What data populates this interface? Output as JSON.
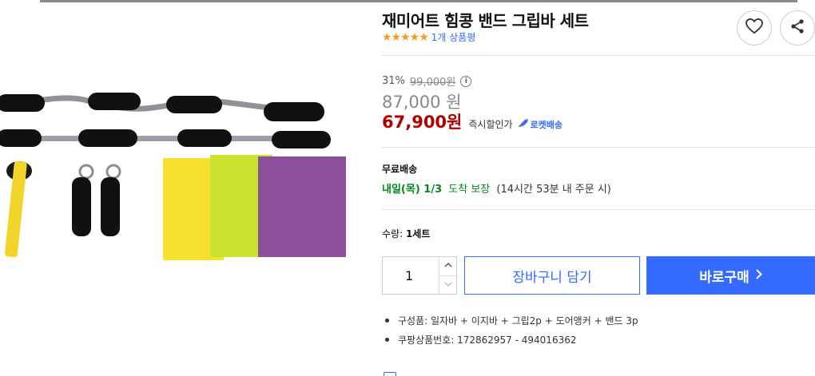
{
  "product": {
    "title": "재미어트 힘콩 밴드 그립바 세트",
    "stars": "★★★★★",
    "review_count": "1개 상품평"
  },
  "icons": {
    "wishlist": "heart-icon",
    "share": "share-icon",
    "price_info": "info-icon",
    "rocket": "rocket-icon",
    "qty_up": "chevron-up-icon",
    "qty_down": "chevron-down-icon",
    "buy_arrow": "chevron-right-icon"
  },
  "price": {
    "discount_rate": "31%",
    "original_price": "99,000원",
    "wow_price": "87,000 원",
    "sale_price": "67,900원",
    "instant_discount_label": "즉시할인가",
    "rocket_label": "로켓배송"
  },
  "shipping": {
    "label": "무료배송",
    "delivery_date": "내일(목) 1/3",
    "guarantee": "도착 보장",
    "condition": "(14시간 53분 내 주문 시)"
  },
  "quantity": {
    "label": "수량:",
    "value_text": "1세트",
    "input_value": "1"
  },
  "actions": {
    "cart_label": "장바구니 담기",
    "buy_label": "바로구매"
  },
  "details": [
    "구성품: 일자바 + 이지바 + 그립2p + 도어앵커 + 밴드 3p",
    "쿠팡상품번호: 172862957 - 494016362"
  ],
  "colors": {
    "accent": "#346aff",
    "sale_price": "#ae0000",
    "delivery": "#00891a",
    "star": "#f49c1b",
    "band_yellow": "#f7e02f",
    "band_lime": "#c8e22d",
    "band_purple": "#8c4f9a"
  }
}
